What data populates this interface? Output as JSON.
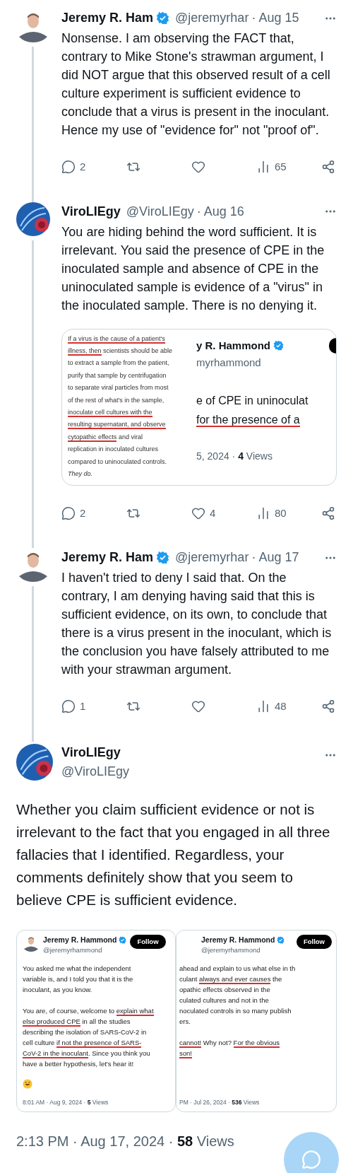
{
  "thread": [
    {
      "avatar": {
        "kind": "person"
      },
      "name": "Jeremy R. Ham",
      "verified": true,
      "handle": "@jeremyrhar",
      "date": "· Aug 15",
      "text": "Nonsense. I am observing the FACT that, contrary to Mike Stone's strawman argument, I did NOT argue that this observed result of a cell culture experiment is sufficient evidence to conclude that a virus is present in the inoculant. Hence my use of \"evidence for\" not \"proof of\".",
      "stats": [
        {
          "kind": "reply",
          "count": "2"
        },
        {
          "kind": "repost"
        },
        {
          "kind": "like"
        },
        {
          "kind": "views",
          "count": "65"
        },
        {
          "kind": "share"
        }
      ]
    },
    {
      "avatar": {
        "kind": "logo"
      },
      "name": "ViroLIEgy",
      "verified": false,
      "handle": "@ViroLIEgy",
      "date": "· Aug 16",
      "text": "You are hiding behind the word sufficient. It is irrelevant. You said the presence of CPE in the inoculated sample and absence of CPE in the uninoculated sample is evidence of a \"virus\" in the inoculated sample. There is no denying it.",
      "media": {
        "excerpt": [
          [
            {
              "text": "If a virus is the cause of a patient's",
              "underlined": true
            }
          ],
          [
            {
              "text": "illness, then",
              "underlined": true
            },
            {
              "text": " scientists should be able",
              "underlined": false
            }
          ],
          [
            {
              "text": "to extract a sample from the patient,",
              "underlined": false
            }
          ],
          [
            {
              "text": "purify that sample by centrifugation",
              "underlined": false
            }
          ],
          [
            {
              "text": "to separate viral particles from most",
              "underlined": false
            }
          ],
          [
            {
              "text": "of the rest of what's in the sample,",
              "underlined": false
            }
          ],
          [
            {
              "text": "inoculate cell cultures with the",
              "underlined": true
            }
          ],
          [
            {
              "text": "resulting supernatant, and observe",
              "underlined": true
            }
          ],
          [
            {
              "text": "cytopathic effects",
              "underlined": true
            },
            {
              "text": " and viral",
              "underlined": false
            }
          ],
          [
            {
              "text": "replication in inoculated cultures",
              "underlined": false
            }
          ],
          [
            {
              "text": "compared to uninoculated controls.",
              "underlined": false
            }
          ],
          [
            {
              "text": "They do.",
              "underlined": false,
              "italic": true
            }
          ]
        ],
        "crop": {
          "name": "y R. Hammond",
          "handle": "myrhammond",
          "lines": [
            [
              {
                "text": "e of CPE in uninoculat",
                "underlined": false
              }
            ],
            [
              {
                "text": "for the presence of a",
                "underlined": true
              }
            ]
          ],
          "date": "5, 2024 ·",
          "views_count": "4",
          "views_label": "Views"
        }
      },
      "stats": [
        {
          "kind": "reply",
          "count": "2"
        },
        {
          "kind": "repost"
        },
        {
          "kind": "like",
          "count": "4"
        },
        {
          "kind": "views",
          "count": "80"
        },
        {
          "kind": "share"
        }
      ]
    },
    {
      "avatar": {
        "kind": "person"
      },
      "name": "Jeremy R. Ham",
      "verified": true,
      "handle": "@jeremyrhar",
      "date": "· Aug 17",
      "text": "I haven't tried to deny I said that. On the contrary, I am denying having said that this is sufficient evidence, on its own, to conclude that there is a virus present in the inoculant, which is the conclusion you have falsely attributed to me with your strawman argument.",
      "stats": [
        {
          "kind": "reply",
          "count": "1"
        },
        {
          "kind": "repost"
        },
        {
          "kind": "like"
        },
        {
          "kind": "views",
          "count": "48"
        },
        {
          "kind": "share"
        }
      ]
    }
  ],
  "main": {
    "avatar": {
      "kind": "logo"
    },
    "name": "ViroLIEgy",
    "handle": "@ViroLIEgy",
    "text": "Whether you claim sufficient evidence or not is irrelevant to the fact that you engaged in all three fallacies that I identified. Regardless, your comments definitely show that you seem to believe CPE is sufficient evidence.",
    "screenshots": [
      {
        "name": "Jeremy R. Hammond",
        "handle": "@jeremyrhammond",
        "follow": "Follow",
        "paragraphs": [
          [
            [
              {
                "text": "You asked me what the independent",
                "underlined": false
              }
            ],
            [
              {
                "text": "variable is, and I told you that it is the",
                "underlined": false
              }
            ],
            [
              {
                "text": "inoculant, as you know.",
                "underlined": false
              }
            ]
          ],
          [
            [
              {
                "text": "You are, of course, welcome to ",
                "underlined": false
              },
              {
                "text": "explain what",
                "underlined": true
              }
            ],
            [
              {
                "text": "else produced CPE",
                "underlined": true
              },
              {
                "text": " in all the studies",
                "underlined": false
              }
            ],
            [
              {
                "text": "describing the isolation of SARS-CoV-2 in",
                "underlined": false
              }
            ],
            [
              {
                "text": "cell culture ",
                "underlined": false
              },
              {
                "text": "if not the presence of SARS-",
                "underlined": true
              }
            ],
            [
              {
                "text": "CoV-2 in the inoculant",
                "underlined": true
              },
              {
                "text": ". Since you think you",
                "underlined": false
              }
            ],
            [
              {
                "text": "have a better hypothesis, let's hear it!",
                "underlined": false
              }
            ]
          ]
        ],
        "emoji": true,
        "date": "8:01 AM · Aug 9, 2024 ·",
        "views_count": "5",
        "views_label": "Views"
      },
      {
        "name": "Jeremy R. Hammond",
        "handle": "@jeremyrhammond",
        "follow": "Follow",
        "paragraphs": [
          [
            [
              {
                "text": "ahead and explain to us what else in th",
                "underlined": false
              }
            ],
            [
              {
                "text": "culant ",
                "underlined": false
              },
              {
                "text": "always and ever causes",
                "underlined": true
              },
              {
                "text": " the",
                "underlined": false
              }
            ],
            [
              {
                "text": "opathic effects observed in the",
                "underlined": false
              }
            ],
            [
              {
                "text": "culated cultures and not in the",
                "underlined": false
              }
            ],
            [
              {
                "text": "noculated controls in so many publish",
                "underlined": false
              }
            ],
            [
              {
                "text": "ers.",
                "underlined": false
              }
            ]
          ],
          [
            [
              {
                "text": "cannot!",
                "underlined": true
              },
              {
                "text": " Why not? ",
                "underlined": false
              },
              {
                "text": "For the obvious",
                "underlined": true
              }
            ],
            [
              {
                "text": "son!",
                "underlined": true
              }
            ]
          ]
        ],
        "emoji": false,
        "date": "PM · Jul 26, 2024 ·",
        "views_count": "536",
        "views_label": "Views"
      }
    ],
    "time": "2:13 PM · Aug 17, 2024 ·",
    "views_count": "58",
    "views_label": "Views"
  }
}
